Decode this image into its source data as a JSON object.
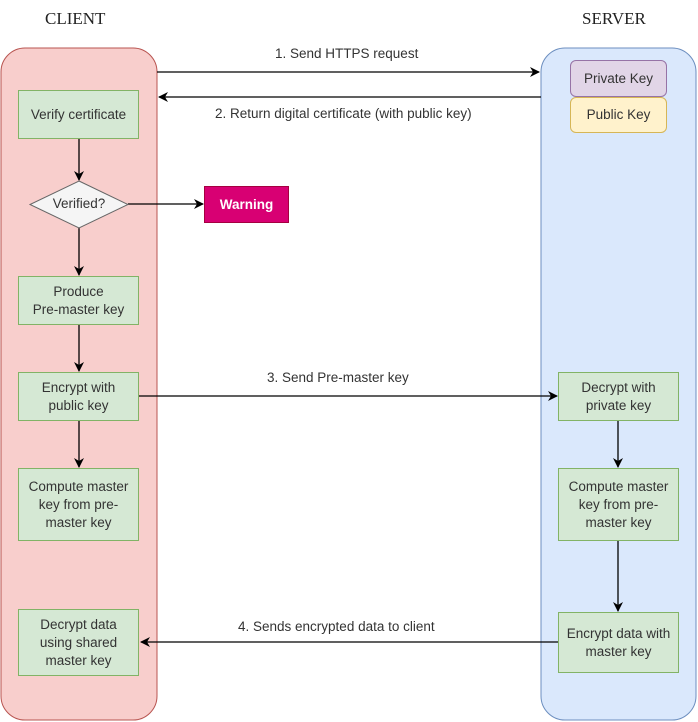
{
  "lanes": {
    "client": {
      "title": "CLIENT",
      "fill": "#f8cecc",
      "stroke": "#b85450"
    },
    "server": {
      "title": "SERVER",
      "fill": "#dae8fc",
      "stroke": "#6c8ebf"
    }
  },
  "server_keys": {
    "private_key": {
      "label": "Private Key",
      "fill": "#e1d5e7",
      "stroke": "#9673a6"
    },
    "public_key": {
      "label": "Public Key",
      "fill": "#fff2cc",
      "stroke": "#d6b656"
    }
  },
  "client_steps": {
    "verify_certificate": "Verify certificate",
    "verified_decision": "Verified?",
    "warning": "Warning",
    "produce_premaster": "Produce\nPre-master key",
    "encrypt_public": "Encrypt with\npublic key",
    "compute_master": "Compute master\nkey from pre-\nmaster key",
    "decrypt_data": "Decrypt data\nusing shared\nmaster key"
  },
  "server_steps": {
    "decrypt_private": "Decrypt with\nprivate key",
    "compute_master": "Compute master\nkey from pre-\nmaster key",
    "encrypt_data": "Encrypt data with\nmaster key"
  },
  "messages": {
    "m1": "1. Send HTTPS request",
    "m2": "2. Return digital certificate (with public key)",
    "m3": "3. Send Pre-master key",
    "m4": "4. Sends encrypted data to client"
  },
  "colors": {
    "step_fill": "#d5e8d4",
    "step_stroke": "#82b366",
    "decision_fill": "#f5f5f5",
    "decision_stroke": "#666666",
    "warning_fill": "#d80073",
    "warning_stroke": "#a50040",
    "warning_text": "#ffffff"
  }
}
